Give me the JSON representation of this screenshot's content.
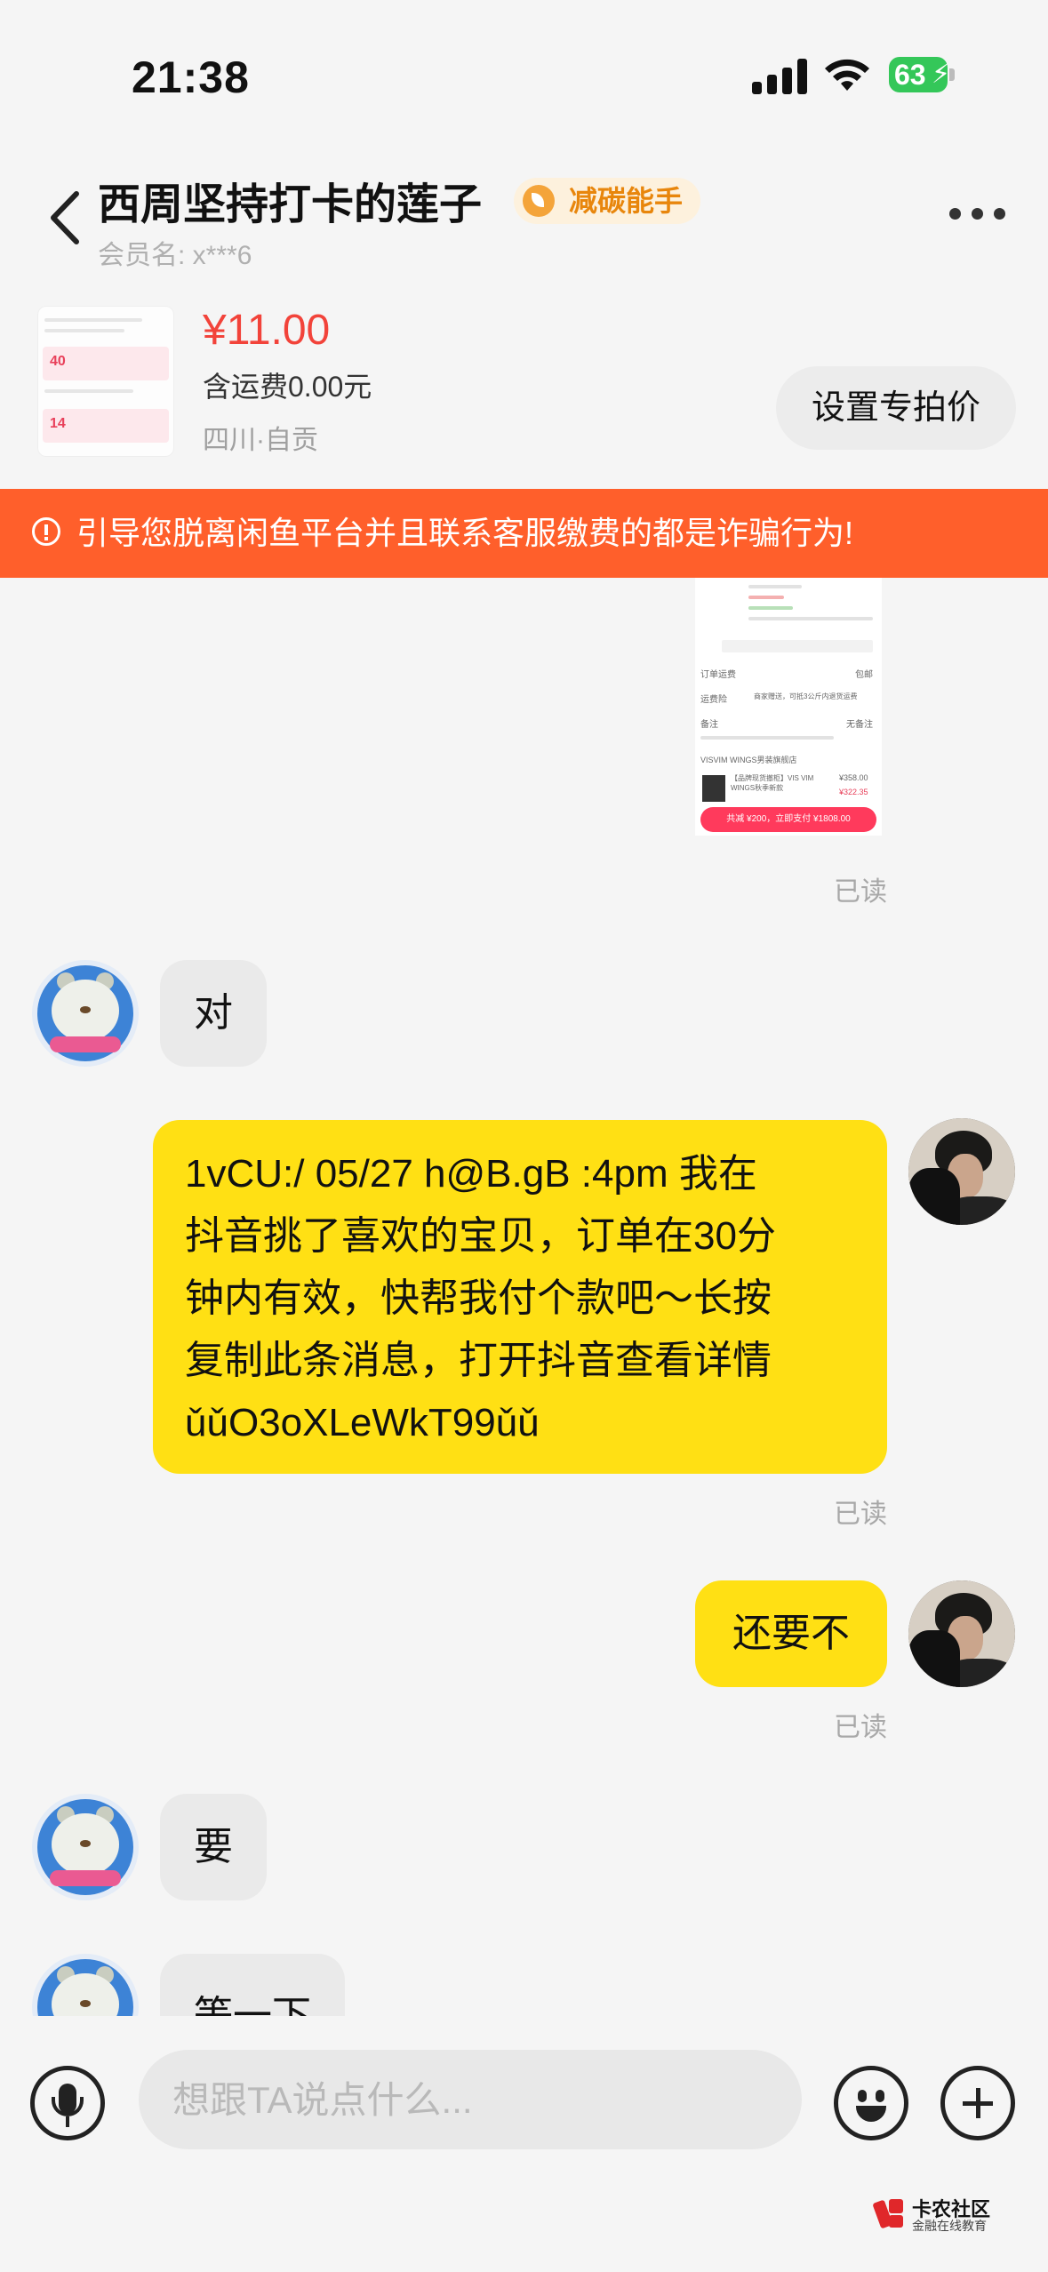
{
  "status_bar": {
    "time": "21:38",
    "battery": "63"
  },
  "header": {
    "shop_name": "西周坚持打卡的莲子",
    "tag": "减碳能手",
    "member_label": "会员名: x***6"
  },
  "product": {
    "price": "¥11.00",
    "shipping": "含运费0.00元",
    "location": "四川·自贡",
    "set_price_button": "设置专拍价",
    "thumb_labels": [
      "40",
      "14"
    ]
  },
  "warning": {
    "text": "引导您脱离闲鱼平台并且联系客服缴费的都是诈骗行为!"
  },
  "screenshot_message": {
    "lines": [
      "订单运费",
      "包邮",
      "运费险",
      "商家赠送，可抵3公斤内退货运费",
      "备注",
      "无备注",
      "VISVIM WINGS男装旗舰店",
      "【品牌现货撤柜】VIS VIM WINGS秋季新款",
      "¥358.00",
      "¥322.35"
    ],
    "pay_text": "共减 ¥200，立即支付 ¥1808.00"
  },
  "messages": {
    "read_1": "已读",
    "seller_1": "对",
    "me_long": "1vCU:/ 05/27 h@B.gB :4pm 我在抖音挑了喜欢的宝贝，订单在30分钟内有效，快帮我付个款吧～长按复制此条消息，打开抖音查看详情ǔǔO3oXLeWkT99ǔǔ",
    "me_long_lines": [
      "1vCU:/ 05/27 h@B.gB :4pm 我在",
      "抖音挑了喜欢的宝贝，订单在30分",
      "钟内有效，快帮我付个款吧～长按",
      "复制此条消息，打开抖音查看详情",
      "ǔǔO3oXLeWkT99ǔǔ"
    ],
    "read_2": "已读",
    "me_short": "还要不",
    "read_3": "已读",
    "seller_2": "要",
    "seller_3": "等一下"
  },
  "input": {
    "placeholder": "想跟TA说点什么..."
  },
  "watermark": {
    "title": "卡农社区",
    "subtitle": "金融在线教育"
  },
  "colors": {
    "accent_yellow": "#ffe014",
    "warning_orange": "#ff5f2b",
    "price_red": "#f2433a"
  },
  "icons": [
    "back-arrow-icon",
    "more-dots-icon",
    "leaf-icon",
    "warning-icon",
    "microphone-icon",
    "emoji-icon",
    "plus-icon"
  ]
}
